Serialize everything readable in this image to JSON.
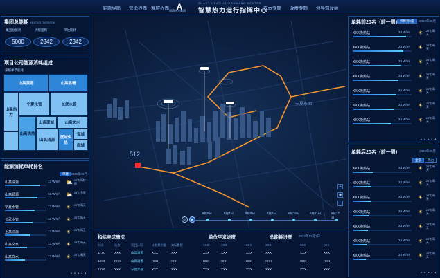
{
  "header": {
    "nav_left": [
      "能源界面",
      "营运界面",
      "客服界面"
    ],
    "nav_right": [
      "成本专题",
      "收费专题",
      "领导驾驶舱"
    ],
    "brand": "国网热力集团",
    "title_en": "SMART HEATING COMMAND CENTER",
    "title": "智慧热力运行指挥中心"
  },
  "group_energy": {
    "title": "集团总能耗",
    "title_en": "HEATING OVERVIEW",
    "kpis": [
      {
        "label": "集团总能耗",
        "value": "5000"
      },
      {
        "label": "供暖面积",
        "value": "2342"
      },
      {
        "label": "单位能耗",
        "value": "2342"
      }
    ]
  },
  "composition": {
    "title": "项目公司能源消耗组成",
    "subtitle": "采暖季节能耗",
    "cells": [
      "山高源源",
      "山高县署",
      "山高热力",
      "宁夏水管",
      "长武水管",
      "山高供热",
      "山高厦城",
      "山高文水",
      "山高清源",
      "厦城供热",
      "深城",
      "阔城"
    ]
  },
  "consumption_rank": {
    "title": "能源消耗单耗排名",
    "tab": "单耗",
    "date": "2022年08月",
    "rows": [
      {
        "name": "山高清源",
        "value": "13 W/m²",
        "temp": "26℃ 晴转阴",
        "icon": "cloud-sun-icon",
        "pct": 0.85
      },
      {
        "name": "山高源源",
        "value": "13 W/m²",
        "temp": "26℃ 多云",
        "icon": "cloud-sun-icon",
        "pct": 0.78
      },
      {
        "name": "宁夏水管",
        "value": "13 W/m²",
        "temp": "26℃ 晴天",
        "icon": "sun-icon",
        "pct": 0.72
      },
      {
        "name": "长武水管",
        "value": "13 W/m²",
        "temp": "26℃ 晴天",
        "icon": "sun-icon",
        "pct": 0.66
      },
      {
        "name": "上高清源",
        "value": "13 W/m²",
        "temp": "26℃ 晴天",
        "icon": "sun-icon",
        "pct": 0.6
      },
      {
        "name": "山高文水",
        "value": "13 W/m²",
        "temp": "26℃ 晴天",
        "icon": "sun-icon",
        "pct": 0.54
      },
      {
        "name": "山高文水",
        "value": "13 W/m²",
        "temp": "26℃ 晴天",
        "icon": "sun-icon",
        "pct": 0.48
      }
    ]
  },
  "top20": {
    "title": "单耗前20名（前一周）",
    "tag": "折算到0度",
    "date": "2022年08月",
    "rows": [
      {
        "name": "XXX换热站",
        "value": "24 W/m²",
        "temp": "26℃ 晴天",
        "pct": 0.9
      },
      {
        "name": "XXX换热站",
        "value": "24 W/m²",
        "temp": "26℃ 晴天",
        "pct": 0.86
      },
      {
        "name": "XXX换热站",
        "value": "24 W/m²",
        "temp": "26℃ 晴天",
        "pct": 0.82
      },
      {
        "name": "XXX换热站",
        "value": "24 W/m²",
        "temp": "26℃ 晴天",
        "pct": 0.78
      },
      {
        "name": "XXX换热站",
        "value": "24 W/m²",
        "temp": "26℃ 晴天",
        "pct": 0.74
      },
      {
        "name": "XXX换热站",
        "value": "24 W/m²",
        "temp": "26℃ 晴天",
        "pct": 0.7
      },
      {
        "name": "XXX换热站",
        "value": "24 W/m²",
        "temp": "26℃ 晴天",
        "pct": 0.66
      }
    ]
  },
  "bottom20": {
    "title": "单耗后20名（前一周）",
    "date": "2022年08月",
    "tabs": [
      "全部",
      "热力"
    ],
    "rows": [
      {
        "name": "XXX换热站",
        "value": "24 W/m²",
        "temp": "26℃ 晴天",
        "pct": 0.35
      },
      {
        "name": "XXX换热站",
        "value": "24 W/m²",
        "temp": "26℃ 晴天",
        "pct": 0.32
      },
      {
        "name": "XXX换热站",
        "value": "24 W/m²",
        "temp": "26℃ 晴天",
        "pct": 0.3
      },
      {
        "name": "XXX换热站",
        "value": "24 W/m²",
        "temp": "26℃ 晴天",
        "pct": 0.28
      },
      {
        "name": "XXX换热站",
        "value": "24 W/m²",
        "temp": "26℃ 晴天",
        "pct": 0.26
      },
      {
        "name": "XXX换热站",
        "value": "24 W/m²",
        "temp": "26℃ 晴天",
        "pct": 0.24
      },
      {
        "name": "XXX换热站",
        "value": "24 W/m²",
        "temp": "26℃ 晴天",
        "pct": 0.22
      }
    ]
  },
  "map": {
    "district": "宁夏永固",
    "marker": "512",
    "timeline": [
      "8月6日",
      "8月7日",
      "8月8日",
      "8月9日",
      "8月10日",
      "8月11日",
      "8月12日"
    ]
  },
  "bottom": {
    "titles": [
      "指标完成情况",
      "单位平米进度",
      "总能耗进度"
    ],
    "date": "2022年12月1日",
    "headers": [
      "时间",
      "站点",
      "项目公司",
      "计划累积量",
      "实际累积",
      "XXX",
      "XXX",
      "XXX",
      "XXX",
      "XXX",
      "XXX"
    ],
    "rows": [
      [
        "11:00",
        "XXX",
        "山高清源",
        "XXX",
        "XXX",
        "XXX",
        "XXX",
        "XXX",
        "XXX",
        "XXX",
        "XXX"
      ],
      [
        "13:00",
        "XXX",
        "山高清源",
        "XXX",
        "XXX",
        "XXX",
        "XXX",
        "XXX",
        "XXX",
        "XXX",
        "XXX"
      ],
      [
        "14:00",
        "XXX",
        "宁夏水管",
        "XXX",
        "XXX",
        "XXX",
        "XXX",
        "XXX",
        "XXX",
        "XXX",
        "XXX"
      ]
    ]
  }
}
